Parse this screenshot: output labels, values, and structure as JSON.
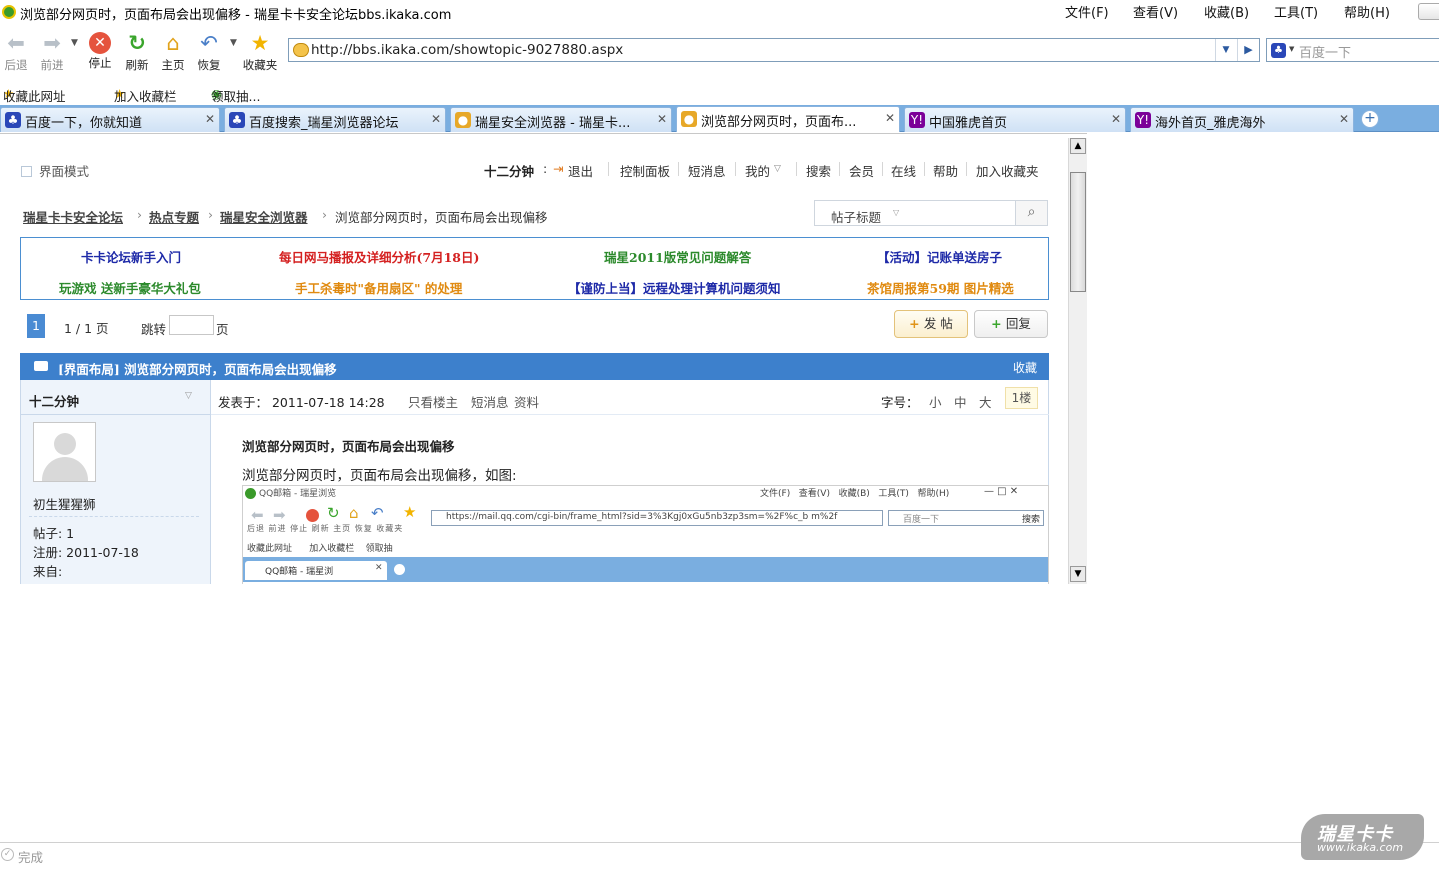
{
  "window": {
    "title": "浏览部分网页时，页面布局会出现偏移 - 瑞星卡卡安全论坛bbs.ikaka.com",
    "menu": [
      "文件(F)",
      "查看(V)",
      "收藏(B)",
      "工具(T)",
      "帮助(H)"
    ]
  },
  "toolbar": {
    "buttons": [
      "后退",
      "前进",
      "停止",
      "刷新",
      "主页",
      "恢复",
      "收藏夹"
    ],
    "address": "http://bbs.ikaka.com/showtopic-9027880.aspx",
    "search_placeholder": "百度一下"
  },
  "favbar": {
    "items": [
      "收藏此网址",
      "加入收藏栏",
      "领取抽..."
    ]
  },
  "tabs": [
    {
      "label": "百度一下，你就知道",
      "icon": "paw-icon",
      "color": "#2a47b8"
    },
    {
      "label": "百度搜索_瑞星浏览器论坛",
      "icon": "paw-icon",
      "color": "#2a47b8"
    },
    {
      "label": "瑞星安全浏览器 - 瑞星卡...",
      "icon": "rising-icon",
      "color": "#e7a828"
    },
    {
      "label": "浏览部分网页时，页面布...",
      "icon": "rising-icon",
      "color": "#e7a828"
    },
    {
      "label": "中国雅虎首页",
      "icon": "yahoo-icon",
      "color": "#7b0099"
    },
    {
      "label": "海外首页_雅虎海外",
      "icon": "yahoo-icon",
      "color": "#7b0099"
    }
  ],
  "page": {
    "mode_label": "界面模式",
    "user": "十二分钟",
    "topnav": [
      "退出",
      "控制面板",
      "短消息",
      "我的",
      "搜索",
      "会员",
      "在线",
      "帮助",
      "加入收藏夹"
    ],
    "breadcrumb": [
      "瑞星卡卡安全论坛",
      "热点专题",
      "瑞星安全浏览器",
      "浏览部分网页时，页面布局会出现偏移"
    ],
    "search_scope": "帖子标题",
    "notices": [
      {
        "text": "卡卡论坛新手入门",
        "color": "#1e2aa8"
      },
      {
        "text": "每日网马播报及详细分析(7月18日)",
        "color": "#d42020"
      },
      {
        "text": "瑞星2011版常见问题解答",
        "color": "#2c8a2c"
      },
      {
        "text": "【活动】记账单送房子",
        "color": "#1e2aa8"
      },
      {
        "text": "玩游戏 送新手豪华大礼包",
        "color": "#2c8a2c"
      },
      {
        "text": "手工杀毒时\"备用扇区\" 的处理",
        "color": "#e08a10"
      },
      {
        "text": "【谨防上当】远程处理计算机问题须知",
        "color": "#1e2aa8"
      },
      {
        "text": "茶馆周报第59期 图片精选",
        "color": "#e08a10"
      }
    ],
    "pager": {
      "current": "1",
      "summary": "1 / 1 页",
      "jump": "跳转",
      "page_unit": "页"
    },
    "post_button": "发 帖",
    "reply_button": "回复",
    "thread_title": "[界面布局] 浏览部分网页时，页面布局会出现偏移",
    "favorite": "收藏",
    "author": {
      "name": "十二分钟",
      "rank": "初生猩猩狮",
      "posts": "帖子: 1",
      "registered": "注册:  2011-07-18",
      "from": "来自:"
    },
    "post": {
      "posted_at": "发表于：  2011-07-18 14:28",
      "only_op": "只看楼主",
      "pm": "短消息",
      "profile": "资料",
      "font_label": "字号：",
      "font_sizes": [
        "小",
        "中",
        "大"
      ],
      "floor": "1楼",
      "subject": "浏览部分网页时，页面布局会出现偏移",
      "body": "浏览部分网页时，页面布局会出现偏移，如图:"
    },
    "embedded": {
      "title": "QQ邮箱 - 瑞星浏览",
      "menu": [
        "文件(F)",
        "查看(V)",
        "收藏(B)",
        "工具(T)",
        "帮助(H)"
      ],
      "toolbar": [
        "后退",
        "前进",
        "停止",
        "刷新",
        "主页",
        "恢复",
        "收藏夹"
      ],
      "address": "https://mail.qq.com/cgi-bin/frame_html?sid=3%3Kgj0xGu5nb3zp3sm=%2F%c_b m%2f",
      "search": "百度一下",
      "search_btn": "搜索",
      "fav": [
        "收藏此网址",
        "加入收藏栏",
        "领取抽"
      ],
      "tab": "QQ邮箱 - 瑞星浏"
    }
  },
  "status": {
    "text": "完成",
    "logo_cn": "瑞星卡卡",
    "logo_url": "www.ikaka.com"
  }
}
